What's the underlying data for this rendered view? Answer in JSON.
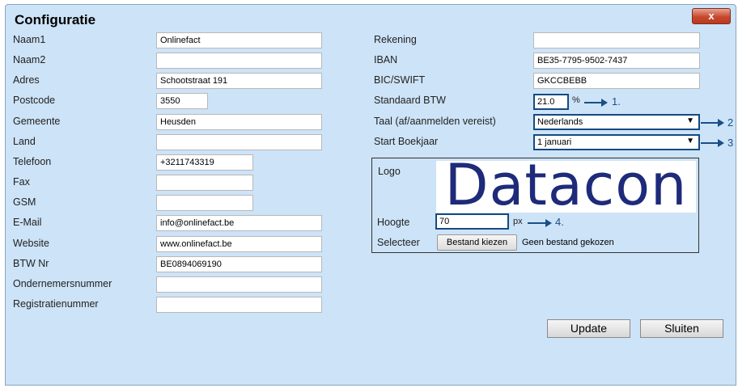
{
  "dialog": {
    "title": "Configuratie",
    "close_label": "x"
  },
  "left_form": [
    {
      "label": "Naam1",
      "value": "Onlinefact"
    },
    {
      "label": "Naam2",
      "value": ""
    },
    {
      "label": "Adres",
      "value": "Schootstraat 191"
    },
    {
      "label": "Postcode",
      "value": "3550"
    },
    {
      "label": "Gemeente",
      "value": "Heusden"
    },
    {
      "label": "Land",
      "value": ""
    },
    {
      "label": "Telefoon",
      "value": "+3211743319"
    },
    {
      "label": "Fax",
      "value": ""
    },
    {
      "label": "GSM",
      "value": ""
    },
    {
      "label": "E-Mail",
      "value": "info@onlinefact.be"
    },
    {
      "label": "Website",
      "value": "www.onlinefact.be"
    },
    {
      "label": "BTW Nr",
      "value": "BE0894069190"
    },
    {
      "label": "Ondernemersnummer",
      "value": ""
    },
    {
      "label": "Registratienummer",
      "value": ""
    }
  ],
  "right_form": {
    "rekening": {
      "label": "Rekening",
      "value": ""
    },
    "iban": {
      "label": "IBAN",
      "value": "BE35-7795-9502-7437"
    },
    "bic": {
      "label": "BIC/SWIFT",
      "value": "GKCCBEBB"
    },
    "btw": {
      "label": "Standaard BTW",
      "value": "21.0",
      "unit": "%"
    },
    "taal": {
      "label": "Taal (af/aanmelden vereist)",
      "value": "Nederlands"
    },
    "boekjaar": {
      "label": "Start Boekjaar",
      "value": "1 januari"
    }
  },
  "logo_section": {
    "label": "Logo",
    "logo_text": "Datacon",
    "hoogte_label": "Hoogte",
    "hoogte_value": "70",
    "hoogte_unit": "px",
    "selecteer_label": "Selecteer",
    "file_button": "Bestand kiezen",
    "file_status": "Geen bestand gekozen"
  },
  "annotations": {
    "a1": "1.",
    "a2": "2",
    "a3": "3",
    "a4": "4."
  },
  "buttons": {
    "update": "Update",
    "sluiten": "Sluiten"
  },
  "colors": {
    "dialog_bg": "#cde3f7",
    "highlight_border": "#144a80",
    "logo_blue": "#1e2b7a",
    "close_red": "#c9482d"
  }
}
